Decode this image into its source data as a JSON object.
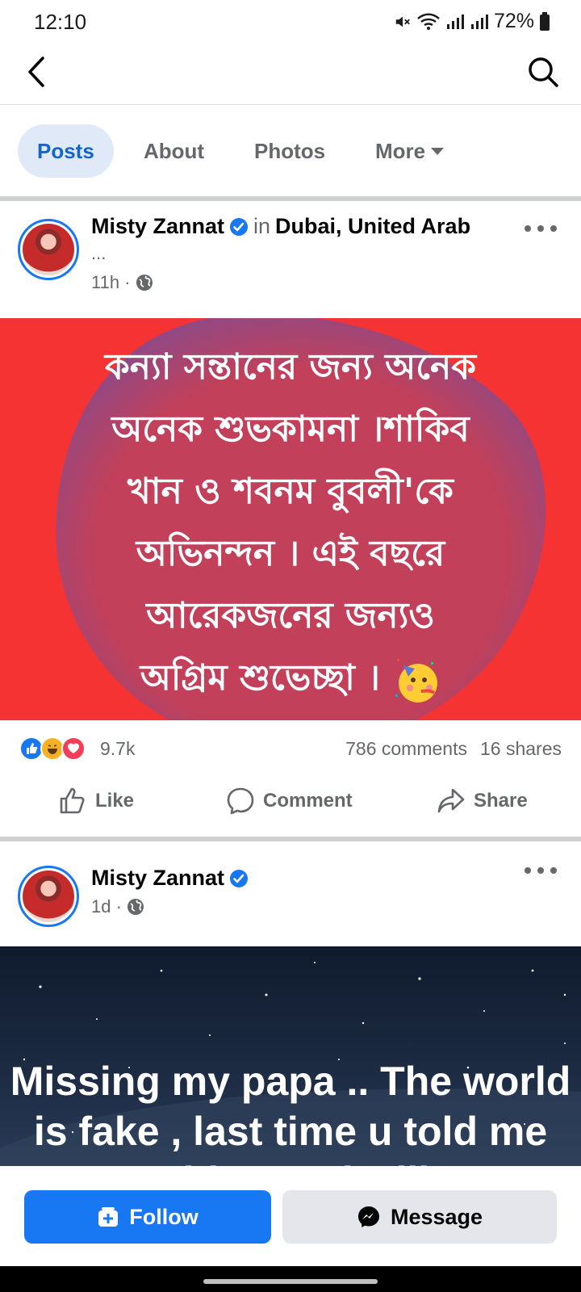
{
  "status_bar": {
    "time": "12:10",
    "battery": "72%",
    "icons": [
      "mute-icon",
      "wifi-icon",
      "signal-icon",
      "signal-icon",
      "battery-icon"
    ]
  },
  "header": {
    "back_icon": "chevron-left-icon",
    "search_icon": "search-icon"
  },
  "tabs": [
    {
      "label": "Posts",
      "active": true
    },
    {
      "label": "About",
      "active": false
    },
    {
      "label": "Photos",
      "active": false
    },
    {
      "label": "More",
      "active": false
    }
  ],
  "posts": [
    {
      "author": "Misty Zannat",
      "verified": true,
      "location_prefix": "in",
      "location": "Dubai, United Arab",
      "ellipsis": "...",
      "time": "11h ·",
      "privacy_icon": "globe-icon",
      "image_text_lines": [
        "কন্যা সন্তানের  জন্য অনেক",
        "অনেক শুভকামনা ।শাকিব",
        "খান ও শবনম বুবলী'কে",
        "অভিনন্দন । এই বছরে",
        "আরেকজনের জন্যও",
        "অগ্রিম শুভেচ্ছা ।"
      ],
      "image_bg_color": "#f53333",
      "reactions": [
        "like",
        "haha",
        "love"
      ],
      "reaction_count": "9.7k",
      "comments": "786 comments",
      "shares": "16 shares",
      "actions": {
        "like": "Like",
        "comment": "Comment",
        "share": "Share"
      }
    },
    {
      "author": "Misty Zannat",
      "verified": true,
      "time": "1d ·",
      "privacy_icon": "globe-icon",
      "image_text": "Missing my papa .. The world is fake , last time u told me without u i will"
    }
  ],
  "bottom": {
    "follow_label": "Follow",
    "message_label": "Message",
    "accent": "#1877f2"
  }
}
